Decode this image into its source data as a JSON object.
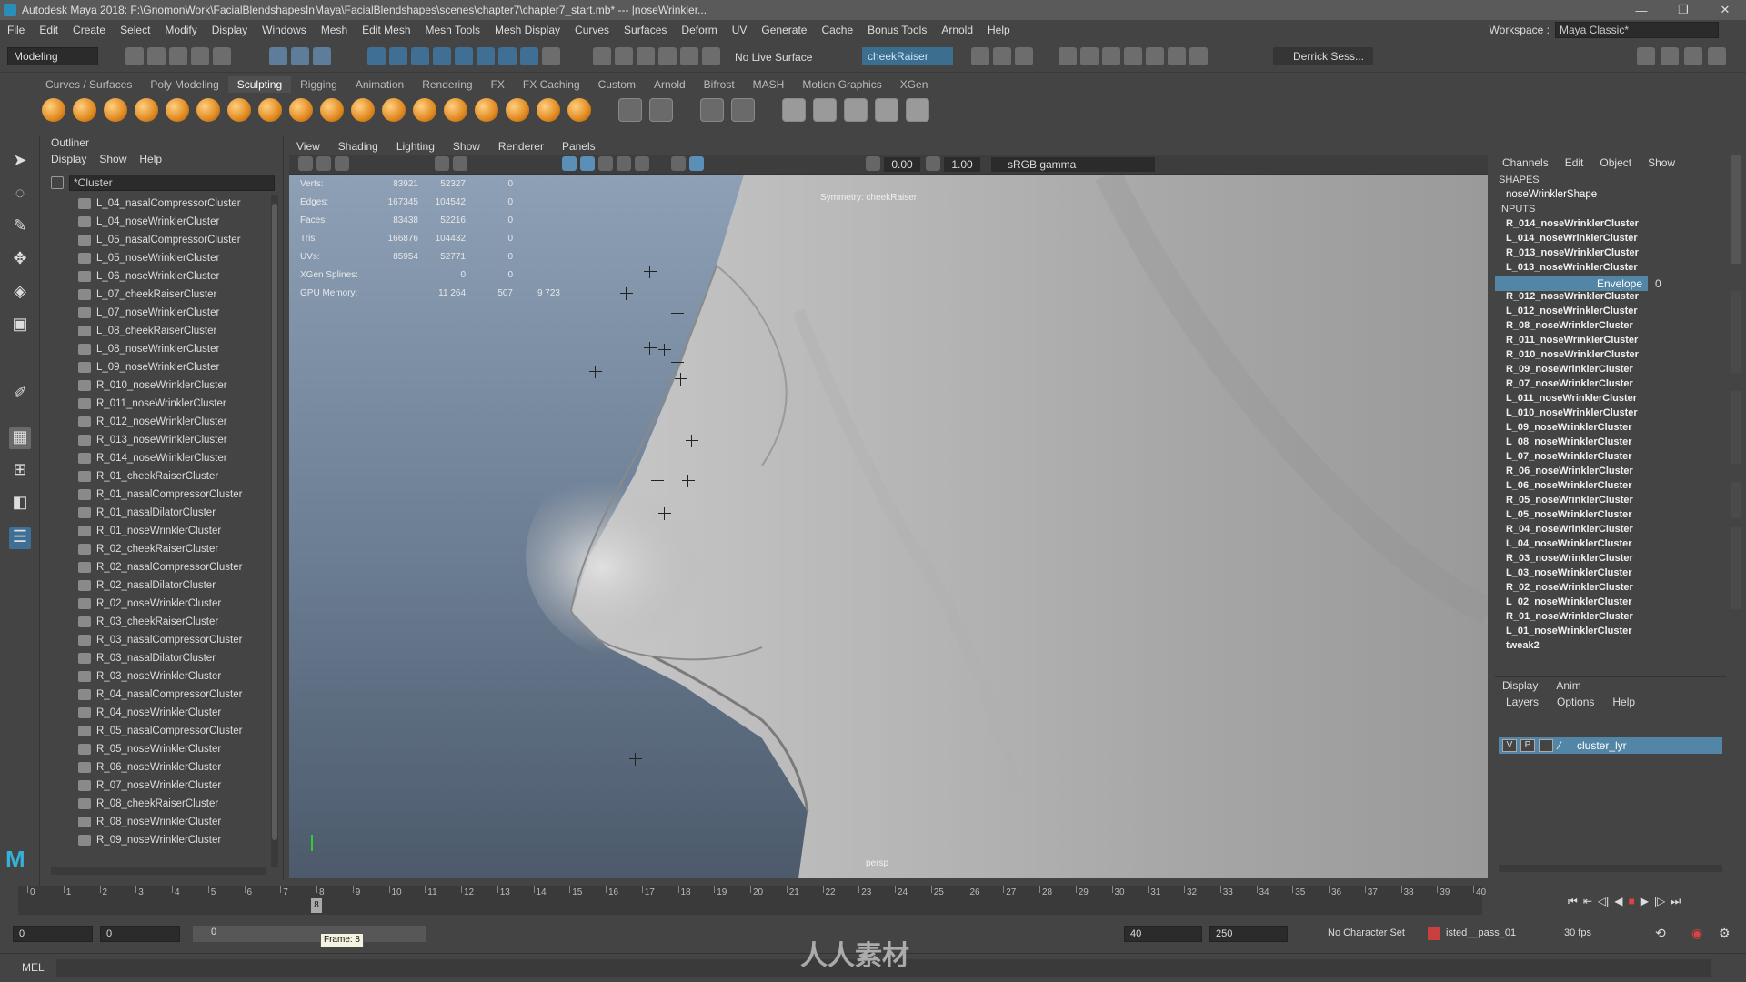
{
  "window": {
    "title": "Autodesk Maya 2018: F:\\GnomonWork\\FacialBlendshapesInMaya\\FacialBlendshapes\\scenes\\chapter7\\chapter7_start.mb*  ---  |noseWrinkler...",
    "controls": [
      "—",
      "❐",
      "✕"
    ]
  },
  "menubar": {
    "items": [
      "File",
      "Edit",
      "Create",
      "Select",
      "Modify",
      "Display",
      "Windows",
      "Mesh",
      "Edit Mesh",
      "Mesh Tools",
      "Mesh Display",
      "Curves",
      "Surfaces",
      "Deform",
      "UV",
      "Generate",
      "Cache",
      "Bonus Tools",
      "Arnold",
      "Help"
    ],
    "workspace_label": "Workspace :",
    "workspace_value": "Maya Classic*"
  },
  "statusline": {
    "mode": "Modeling",
    "live_surface": "No Live Surface",
    "selection_field": "cheekRaiser",
    "user": "Derrick Sess..."
  },
  "shelf": {
    "tabs": [
      "Curves / Surfaces",
      "Poly Modeling",
      "Sculpting",
      "Rigging",
      "Animation",
      "Rendering",
      "FX",
      "FX Caching",
      "Custom",
      "Arnold",
      "Bifrost",
      "MASH",
      "Motion Graphics",
      "XGen"
    ],
    "active_tab": "Sculpting"
  },
  "outliner": {
    "title": "Outliner",
    "menu": [
      "Display",
      "Show",
      "Help"
    ],
    "filter": "*Cluster",
    "items": [
      "L_04_nasalCompressorCluster",
      "L_04_noseWrinklerCluster",
      "L_05_nasalCompressorCluster",
      "L_05_noseWrinklerCluster",
      "L_06_noseWrinklerCluster",
      "L_07_cheekRaiserCluster",
      "L_07_noseWrinklerCluster",
      "L_08_cheekRaiserCluster",
      "L_08_noseWrinklerCluster",
      "L_09_noseWrinklerCluster",
      "R_010_noseWrinklerCluster",
      "R_011_noseWrinklerCluster",
      "R_012_noseWrinklerCluster",
      "R_013_noseWrinklerCluster",
      "R_014_noseWrinklerCluster",
      "R_01_cheekRaiserCluster",
      "R_01_nasalCompressorCluster",
      "R_01_nasalDilatorCluster",
      "R_01_noseWrinklerCluster",
      "R_02_cheekRaiserCluster",
      "R_02_nasalCompressorCluster",
      "R_02_nasalDilatorCluster",
      "R_02_noseWrinklerCluster",
      "R_03_cheekRaiserCluster",
      "R_03_nasalCompressorCluster",
      "R_03_nasalDilatorCluster",
      "R_03_noseWrinklerCluster",
      "R_04_nasalCompressorCluster",
      "R_04_noseWrinklerCluster",
      "R_05_nasalCompressorCluster",
      "R_05_noseWrinklerCluster",
      "R_06_noseWrinklerCluster",
      "R_07_noseWrinklerCluster",
      "R_08_cheekRaiserCluster",
      "R_08_noseWrinklerCluster",
      "R_09_noseWrinklerCluster"
    ]
  },
  "viewport": {
    "menu": [
      "View",
      "Shading",
      "Lighting",
      "Show",
      "Renderer",
      "Panels"
    ],
    "exposure": "0.00",
    "gamma_value": "1.00",
    "color_space": "sRGB gamma",
    "hud": [
      {
        "label": "Verts:",
        "a": "83921",
        "b": "52327",
        "c": "0"
      },
      {
        "label": "Edges:",
        "a": "167345",
        "b": "104542",
        "c": "0"
      },
      {
        "label": "Faces:",
        "a": "83438",
        "b": "52216",
        "c": "0"
      },
      {
        "label": "Tris:",
        "a": "166876",
        "b": "104432",
        "c": "0"
      },
      {
        "label": "UVs:",
        "a": "85954",
        "b": "52771",
        "c": "0"
      },
      {
        "label": "XGen Splines:",
        "a": "",
        "b": "0",
        "c": "0"
      },
      {
        "label": "GPU Memory:",
        "a": "",
        "b": "11 264",
        "c": "507",
        "d": "9 723"
      }
    ],
    "symmetry": "Symmetry: cheekRaiser",
    "camera": "persp"
  },
  "channelbox": {
    "menu": [
      "Channels",
      "Edit",
      "Object",
      "Show"
    ],
    "shapes_label": "SHAPES",
    "shape": "noseWrinklerShape",
    "inputs_label": "INPUTS",
    "inputs_before": [
      "R_014_noseWrinklerCluster",
      "L_014_noseWrinklerCluster",
      "R_013_noseWrinklerCluster",
      "L_013_noseWrinklerCluster"
    ],
    "envelope_label": "Envelope",
    "envelope_value": "0",
    "inputs_after": [
      "R_012_noseWrinklerCluster",
      "L_012_noseWrinklerCluster",
      "R_08_noseWrinklerCluster",
      "R_011_noseWrinklerCluster",
      "R_010_noseWrinklerCluster",
      "R_09_noseWrinklerCluster",
      "R_07_noseWrinklerCluster",
      "L_011_noseWrinklerCluster",
      "L_010_noseWrinklerCluster",
      "L_09_noseWrinklerCluster",
      "L_08_noseWrinklerCluster",
      "L_07_noseWrinklerCluster",
      "R_06_noseWrinklerCluster",
      "L_06_noseWrinklerCluster",
      "R_05_noseWrinklerCluster",
      "L_05_noseWrinklerCluster",
      "R_04_noseWrinklerCluster",
      "L_04_noseWrinklerCluster",
      "R_03_noseWrinklerCluster",
      "L_03_noseWrinklerCluster",
      "R_02_noseWrinklerCluster",
      "L_02_noseWrinklerCluster",
      "R_01_noseWrinklerCluster",
      "L_01_noseWrinklerCluster",
      "tweak2"
    ]
  },
  "layers": {
    "tabs": [
      "Display",
      "Anim"
    ],
    "menu": [
      "Layers",
      "Options",
      "Help"
    ],
    "layer_v": "V",
    "layer_p": "P",
    "layer_name": "cluster_lyr"
  },
  "timeline": {
    "ticks": [
      "0",
      "1",
      "2",
      "3",
      "4",
      "5",
      "6",
      "7",
      "8",
      "9",
      "10",
      "11",
      "12",
      "13",
      "14",
      "15",
      "16",
      "17",
      "18",
      "19",
      "20",
      "21",
      "22",
      "23",
      "24",
      "25",
      "26",
      "27",
      "28",
      "29",
      "30",
      "31",
      "32",
      "33",
      "34",
      "35",
      "36",
      "37",
      "38",
      "39",
      "40"
    ],
    "current_frame": "8"
  },
  "range": {
    "start": "0",
    "playback_start": "0",
    "range_start": "0",
    "frame_tooltip": "Frame: 8",
    "playback_end": "40",
    "end": "250",
    "character_set": "No Character Set",
    "anim_layer": "isted__pass_01",
    "fps": "30 fps"
  },
  "cmdline": {
    "label": "MEL"
  },
  "watermark": "人人素材"
}
